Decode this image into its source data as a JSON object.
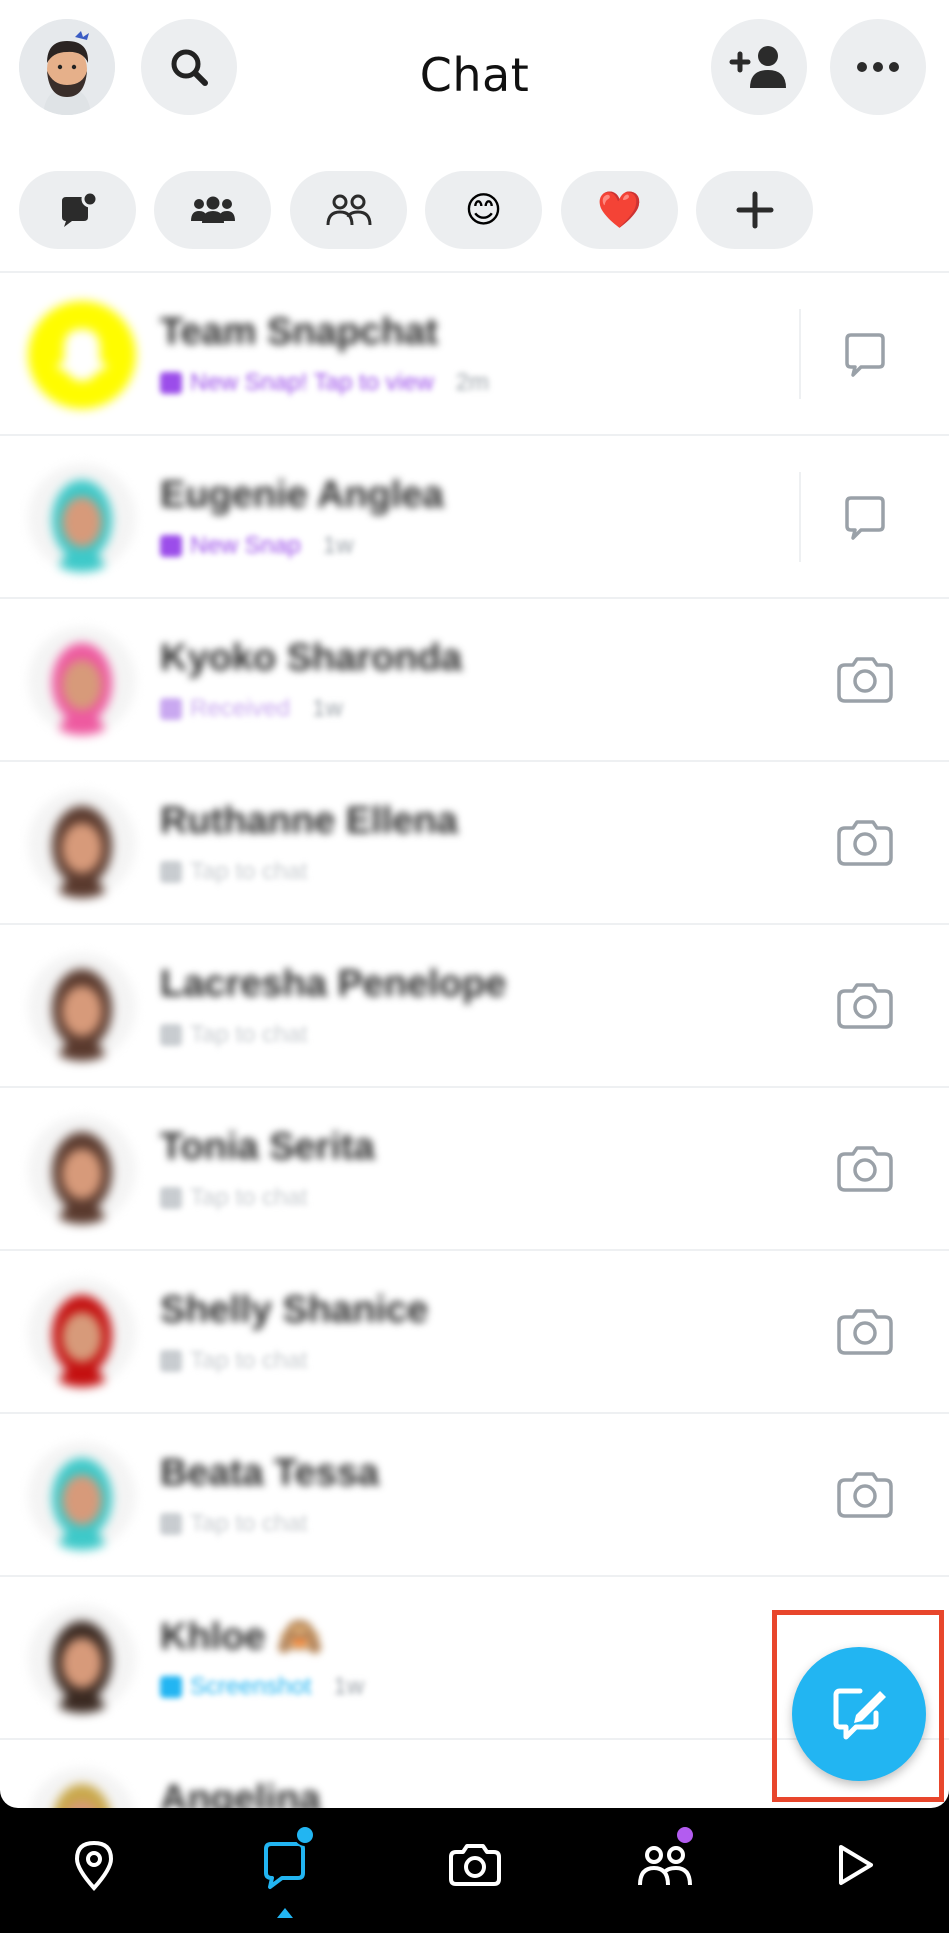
{
  "header": {
    "title": "Chat"
  },
  "filters": [
    {
      "name": "unread-filter",
      "icon": "unread-chat-icon"
    },
    {
      "name": "groups-filter",
      "icon": "group-icon"
    },
    {
      "name": "friends-filter",
      "icon": "friends-icon"
    },
    {
      "name": "best-friends-filter",
      "icon": "smiley-emoji",
      "glyph": "😊"
    },
    {
      "name": "favorites-filter",
      "icon": "heart-emoji",
      "glyph": "❤️"
    },
    {
      "name": "add-filter",
      "icon": "plus-icon"
    }
  ],
  "chats": [
    {
      "name": "Team Snapchat",
      "status": "New Snap! Tap to view",
      "time": "2m",
      "status_color": "#9b4dea",
      "action": "chat-bubble-icon",
      "avatar_color": "#fffc00"
    },
    {
      "name": "Eugenie Anglea",
      "status": "New Snap",
      "time": "1w",
      "status_color": "#9b4dea",
      "action": "chat-bubble-icon",
      "avatar_color": "#3ec9c9"
    },
    {
      "name": "Kyoko Sharonda",
      "status": "Received",
      "time": "1w",
      "status_color": "#c9a8f0",
      "action": "camera-icon",
      "avatar_color": "#ee5aa0"
    },
    {
      "name": "Ruthanne Ellena",
      "status": "Tap to chat",
      "time": "",
      "status_color": "#c8ccd0",
      "action": "camera-icon",
      "avatar_color": "#5a3a2e"
    },
    {
      "name": "Lacresha Penelope",
      "status": "Tap to chat",
      "time": "",
      "status_color": "#c8ccd0",
      "action": "camera-icon",
      "avatar_color": "#5a3a2e"
    },
    {
      "name": "Tonia Serita",
      "status": "Tap to chat",
      "time": "",
      "status_color": "#c8ccd0",
      "action": "camera-icon",
      "avatar_color": "#5a3a2e"
    },
    {
      "name": "Shelly Shanice",
      "status": "Tap to chat",
      "time": "",
      "status_color": "#c8ccd0",
      "action": "camera-icon",
      "avatar_color": "#c41010"
    },
    {
      "name": "Beata Tessa",
      "status": "Tap to chat",
      "time": "",
      "status_color": "#c8ccd0",
      "action": "camera-icon",
      "avatar_color": "#3ec9c9"
    },
    {
      "name": "Khloe 🙈",
      "status": "Screenshot",
      "time": "1w",
      "status_color": "#22b5f2",
      "action": "camera-icon",
      "avatar_color": "#3b2a22"
    },
    {
      "name": "Angelina",
      "status": "",
      "time": "",
      "status_color": "#c8ccd0",
      "action": "camera-icon",
      "avatar_color": "#c9a84a"
    }
  ],
  "colors": {
    "accent_blue": "#22b5f2",
    "highlight_red": "#e8462c",
    "nav_dot_blue": "#22b5f2",
    "nav_dot_purple": "#b35cf0"
  },
  "nav": [
    {
      "name": "map",
      "icon": "map-pin-icon"
    },
    {
      "name": "chat",
      "icon": "chat-icon",
      "active": true
    },
    {
      "name": "camera",
      "icon": "camera-icon"
    },
    {
      "name": "stories",
      "icon": "friends-icon"
    },
    {
      "name": "spotlight",
      "icon": "play-icon"
    }
  ]
}
